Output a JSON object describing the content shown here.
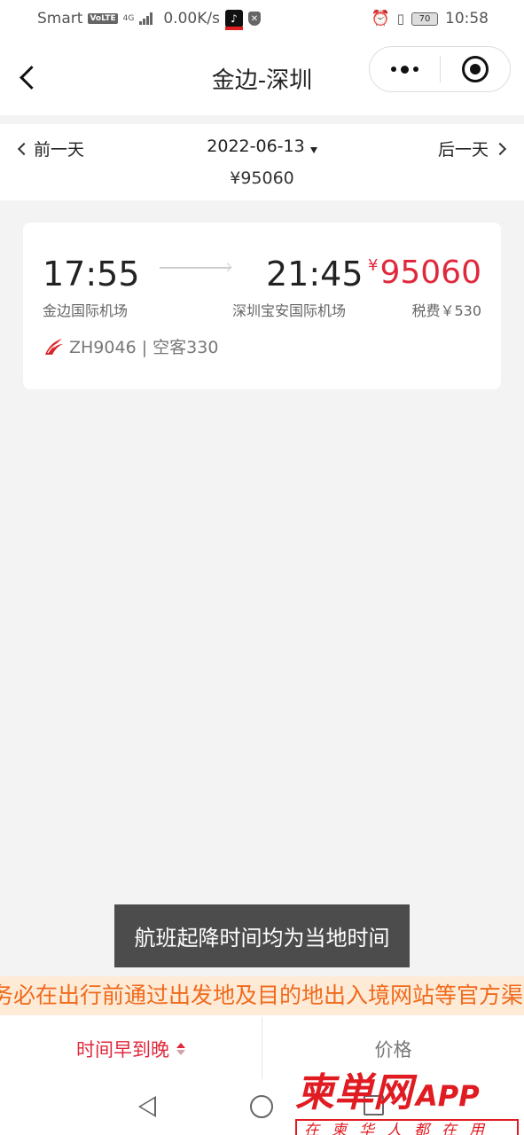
{
  "status_bar": {
    "carrier": "Smart",
    "volte": "VoLTE",
    "network": "4G",
    "speed": "0.00K/s",
    "battery": "70",
    "time": "10:58"
  },
  "header": {
    "title": "金边-深圳"
  },
  "date_bar": {
    "prev_label": "前一天",
    "date": "2022-06-13",
    "next_label": "后一天",
    "lowest_price": "¥95060"
  },
  "flight": {
    "dep_time": "17:55",
    "dep_airport": "金边国际机场",
    "arr_time": "21:45",
    "arr_airport": "深圳宝安国际机场",
    "currency": "¥",
    "price": "95060",
    "tax": "税费￥530",
    "flight_no_type": "ZH9046 | 空客330",
    "airline_color": "#d9262c"
  },
  "toast": {
    "message": "航班起降时间均为当地时间"
  },
  "notice": {
    "text": "务必在出行前通过出发地及目的地出入境网站等官方渠"
  },
  "sort_bar": {
    "time_label": "时间早到晚",
    "price_label": "价格"
  },
  "watermark": {
    "name": "柬単网",
    "app": "APP",
    "slogan": "在柬华人都在用"
  },
  "colors": {
    "accent_red": "#e0283c",
    "notice_orange": "#f06a1a"
  }
}
